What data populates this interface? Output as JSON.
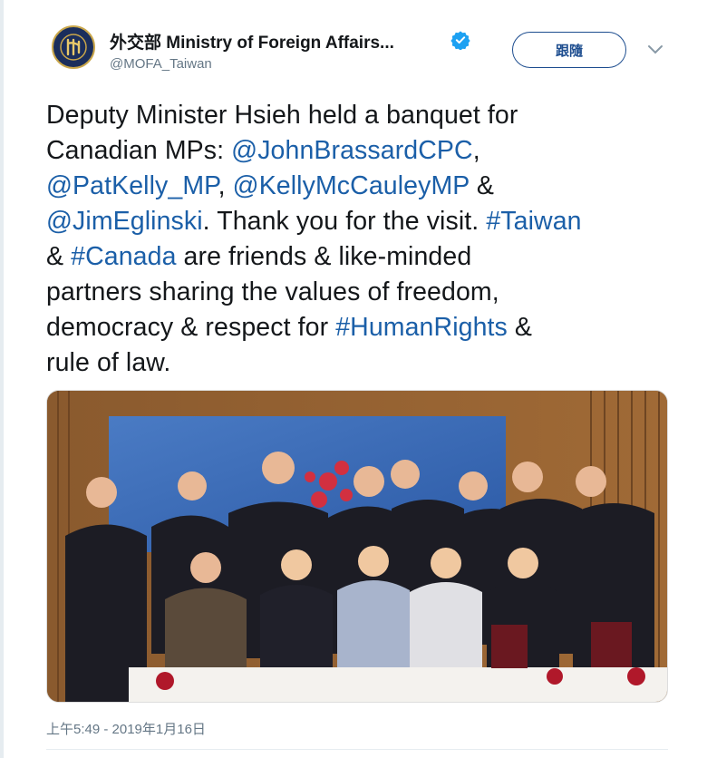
{
  "author": {
    "display_name": "外交部 Ministry of Foreign Affairs...",
    "handle": "@MOFA_Taiwan",
    "verified": true,
    "avatar_icon": "mofa-emblem-icon"
  },
  "follow_label": "跟隨",
  "tweet_text": {
    "line1": "Deputy Minister Hsieh held a banquet for",
    "line2_prefix": "Canadian MPs: ",
    "mention1": "@JohnBrassardCPC",
    "line2_suffix": ",",
    "mention2": "@PatKelly_MP",
    "sep1": ", ",
    "mention3": "@KellyMcCauleyMP",
    "sep2": " &",
    "mention4": "@JimEglinski",
    "line4_mid": ". Thank you for the visit. ",
    "hashtag1": "#Taiwan",
    "line5_prefix": "& ",
    "hashtag2": "#Canada",
    "line5_suffix": " are friends & like-minded",
    "line6": "partners sharing the values of freedom,",
    "line7_prefix": "democracy & respect for ",
    "hashtag3": "#HumanRights",
    "line7_suffix": " &",
    "line8": "rule of law."
  },
  "timestamp": "上午5:49 - 2019年1月16日",
  "colors": {
    "link": "#1b5fa8",
    "follow_border": "#1d4d8f",
    "verified": "#1da1f2",
    "muted": "#657786"
  }
}
